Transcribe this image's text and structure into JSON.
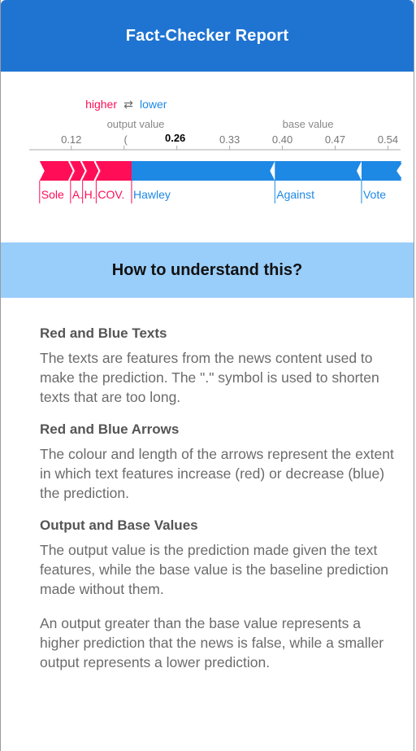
{
  "header": {
    "title": "Fact-Checker Report"
  },
  "legend": {
    "higher": "higher",
    "arrows": "⇄",
    "lower": "lower",
    "output_label": "output value",
    "base_label": "base value"
  },
  "colors": {
    "header_bg": "#1f74d2",
    "banner_bg": "#99cdfa",
    "increase": "#ff0d57",
    "decrease": "#1e88e5"
  },
  "chart_data": {
    "type": "force-plot",
    "x_ticks": [
      0.12,
      0.19,
      0.26,
      0.33,
      0.4,
      0.47,
      0.54
    ],
    "x_tick_labels": [
      "0.12",
      "",
      "",
      "0.33",
      "0.40",
      "0.47",
      "0.54"
    ],
    "xlim": [
      0.075,
      0.56
    ],
    "output_value": 0.26,
    "output_value_label": "0.26",
    "base_value": 0.434,
    "increase_features": [
      {
        "label": "Sole",
        "start": 0.078,
        "end": 0.119
      },
      {
        "label": "A.",
        "start": 0.119,
        "end": 0.135
      },
      {
        "label": "H.",
        "start": 0.135,
        "end": 0.153
      },
      {
        "label": "COV.",
        "start": 0.153,
        "end": 0.2
      }
    ],
    "decrease_features": [
      {
        "label": "Hawley",
        "start": 0.2,
        "end": 0.39
      },
      {
        "label": "Against",
        "start": 0.39,
        "end": 0.505
      },
      {
        "label": "Vote",
        "start": 0.505,
        "end": 0.558
      }
    ]
  },
  "help": {
    "title": "How to understand this?",
    "sections": [
      {
        "heading": "Red and Blue Texts",
        "text": "The texts are features from the news content used to make the prediction. The \".\" symbol is used to shorten texts that are too long."
      },
      {
        "heading": "Red and Blue Arrows",
        "text": "The colour and length of the arrows represent the extent in which text features increase (red) or decrease (blue) the prediction."
      },
      {
        "heading": "Output and Base Values",
        "text": "The output value is the prediction made given the text features, while the base value is the baseline prediction made without them."
      }
    ],
    "closing": "An output greater than the base value represents a higher prediction that the news is false, while a smaller output represents a lower prediction."
  }
}
